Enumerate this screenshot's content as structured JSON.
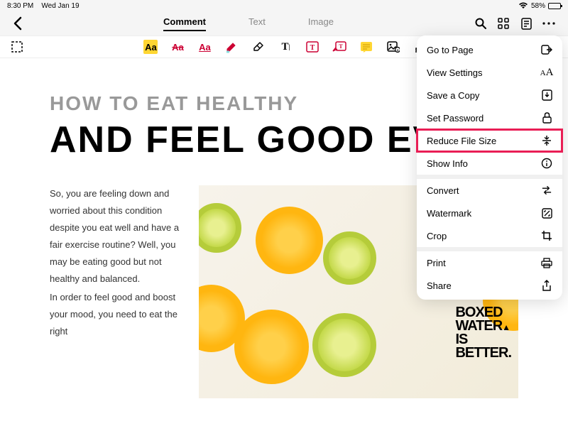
{
  "status": {
    "time": "8:30 PM",
    "date": "Wed Jan 19",
    "battery": "58%"
  },
  "nav": {
    "tabs": [
      "Comment",
      "Text",
      "Image"
    ],
    "active": 0
  },
  "document": {
    "subtitle": "HOW TO EAT HEALTHY",
    "title": "AND FEEL GOOD EVERY",
    "para1": "So, you are feeling down and worried about this condition despite you eat well and have a fair exercise routine? Well, you may be eating good but not healthy and balanced.",
    "para2": "In order to feel good and boost your mood, you need to eat the right",
    "box_lines": [
      "BOXED",
      "WATER",
      "IS",
      "BETTER."
    ]
  },
  "menu": {
    "items": [
      {
        "label": "Go to Page",
        "icon": "goto"
      },
      {
        "label": "View Settings",
        "icon": "viewsettings"
      },
      {
        "label": "Save a Copy",
        "icon": "save"
      },
      {
        "label": "Set Password",
        "icon": "lock"
      },
      {
        "label": "Reduce File Size",
        "icon": "reduce",
        "highlighted": true
      },
      {
        "label": "Show Info",
        "icon": "info"
      },
      {
        "label": "Convert",
        "icon": "convert",
        "group_break": true
      },
      {
        "label": "Watermark",
        "icon": "watermark"
      },
      {
        "label": "Crop",
        "icon": "crop"
      },
      {
        "label": "Print",
        "icon": "print",
        "group_break": true
      },
      {
        "label": "Share",
        "icon": "share"
      }
    ]
  }
}
